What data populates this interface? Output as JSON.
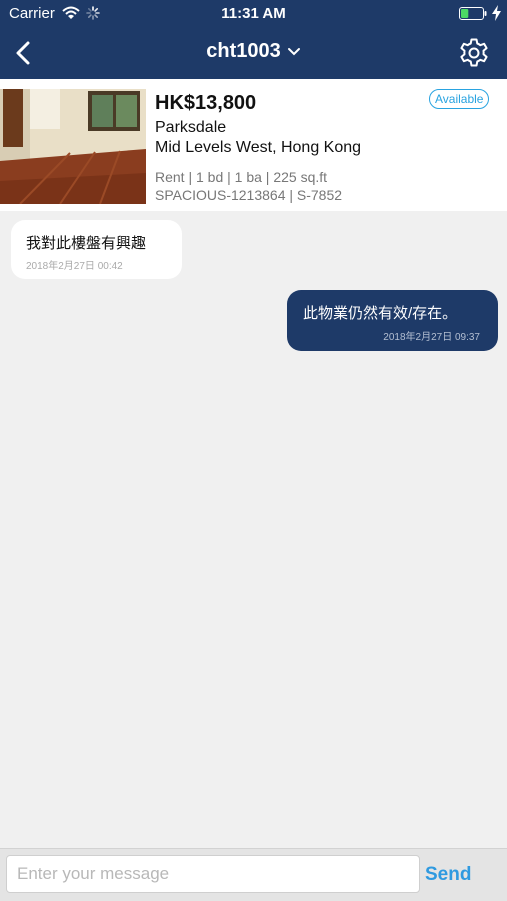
{
  "status_bar": {
    "carrier": "Carrier",
    "time": "11:31 AM",
    "battery_level": 0.35
  },
  "nav": {
    "title": "cht1003"
  },
  "listing": {
    "price": "HK$13,800",
    "name": "Parksdale",
    "area": "Mid Levels West, Hong Kong",
    "meta": "Rent | 1 bd | 1 ba | 225 sq.ft",
    "ref": "SPACIOUS-1213864 | S-7852",
    "badge": "Available"
  },
  "messages": [
    {
      "direction": "incoming",
      "text": "我對此樓盤有興趣",
      "timestamp": "2018年2月27日 00:42"
    },
    {
      "direction": "outgoing",
      "text": "此物業仍然有效/存在。",
      "timestamp": "2018年2月27日 09:37"
    }
  ],
  "composer": {
    "placeholder": "Enter your message",
    "value": "",
    "send_label": "Send"
  },
  "colors": {
    "navbar": "#1e3a68",
    "accent": "#2f9ae0",
    "outgoing_bubble": "#1e3a68"
  }
}
